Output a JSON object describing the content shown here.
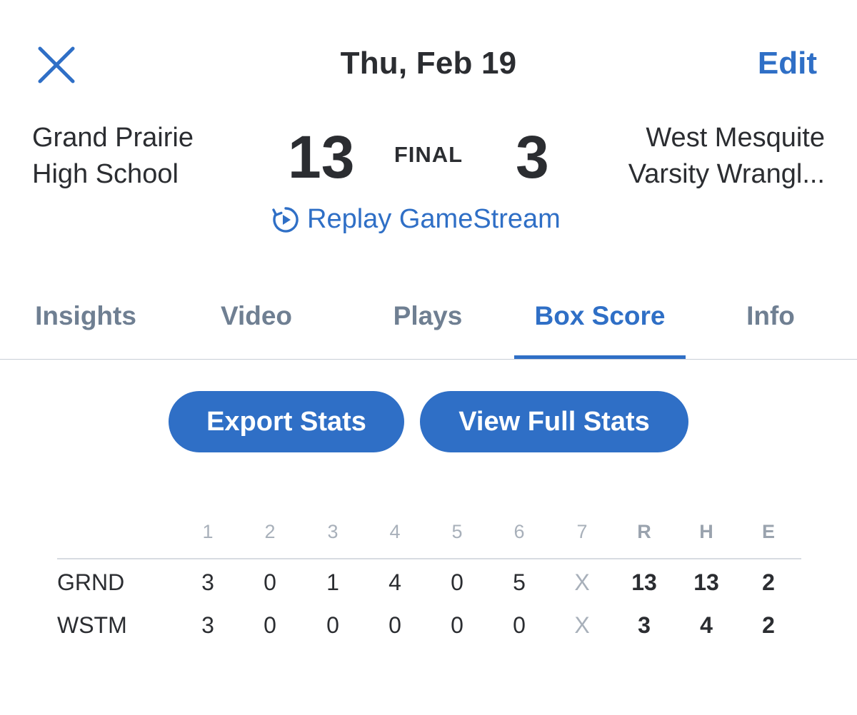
{
  "header": {
    "close_icon": "close-icon",
    "date": "Thu, Feb 19",
    "edit_label": "Edit"
  },
  "scoreboard": {
    "home": {
      "name_line1": "Grand Prairie",
      "name_line2": "High School",
      "score": "13"
    },
    "away": {
      "name_line1": "West Mesquite",
      "name_line2": "Varsity Wrangl...",
      "score": "3"
    },
    "status": "FINAL",
    "replay_label": "Replay GameStream",
    "replay_icon": "replay-icon"
  },
  "tabs": [
    {
      "label": "Insights",
      "active": false
    },
    {
      "label": "Video",
      "active": false
    },
    {
      "label": "Plays",
      "active": false
    },
    {
      "label": "Box Score",
      "active": true
    },
    {
      "label": "Info",
      "active": false
    }
  ],
  "actions": {
    "export_label": "Export Stats",
    "full_stats_label": "View Full Stats"
  },
  "boxscore": {
    "headers": [
      "1",
      "2",
      "3",
      "4",
      "5",
      "6",
      "7",
      "R",
      "H",
      "E"
    ],
    "rows": [
      {
        "team": "GRND",
        "cells": [
          "3",
          "0",
          "1",
          "4",
          "0",
          "5",
          "X",
          "13",
          "13",
          "2"
        ]
      },
      {
        "team": "WSTM",
        "cells": [
          "3",
          "0",
          "0",
          "0",
          "0",
          "0",
          "X",
          "3",
          "4",
          "2"
        ]
      }
    ]
  },
  "colors": {
    "accent": "#2f6fc6",
    "text": "#2b2d31",
    "tab_inactive": "#6f7f92",
    "muted": "#a8b0ba"
  }
}
